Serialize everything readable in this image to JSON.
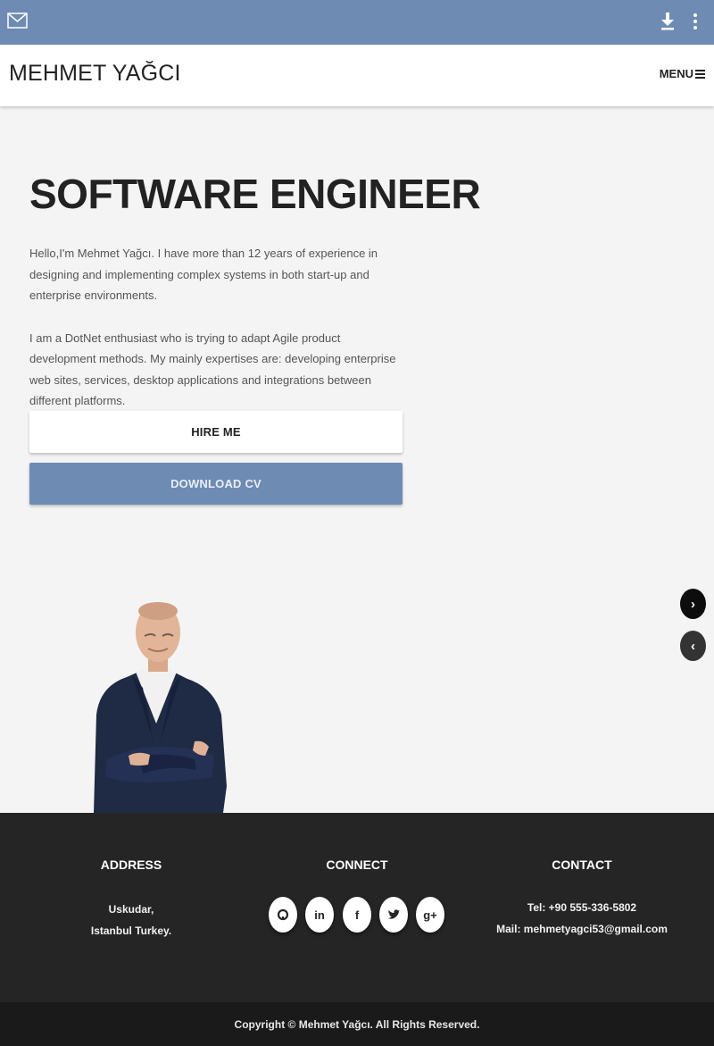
{
  "topbar": {
    "icons": [
      "mail-icon",
      "download-icon",
      "more-vert-icon"
    ],
    "color": "#6e8bb3"
  },
  "navbar": {
    "brand": "MEHMET YAĞCI",
    "menu_label": "MENU"
  },
  "hero": {
    "title": "SOFTWARE ENGINEER",
    "paragraph1": "Hello,I'm Mehmet Yağcı. I have more than 12 years of experience in designing and implementing complex systems in both start-up and enterprise environments.",
    "paragraph2": "I am a DotNet enthusiast who is trying to adapt Agile product development methods. My mainly expertises are: developing enterprise web sites, services, desktop applications and integrations between different platforms.",
    "hire_label": "HIRE ME",
    "cv_label": "DOWNLOAD CV"
  },
  "slider": {
    "next_icon": "›",
    "prev_icon": "‹"
  },
  "footer": {
    "address": {
      "title": "ADDRESS",
      "line1": "Uskudar,",
      "line2": "Istanbul Turkey."
    },
    "connect": {
      "title": "CONNECT",
      "links": [
        {
          "name": "github-icon",
          "glyph": "◯"
        },
        {
          "name": "linkedin-icon",
          "glyph": "in"
        },
        {
          "name": "facebook-icon",
          "glyph": "f"
        },
        {
          "name": "twitter-icon",
          "glyph": "🐦"
        },
        {
          "name": "google-plus-icon",
          "glyph": "g+"
        }
      ]
    },
    "contact": {
      "title": "CONTACT",
      "tel": "Tel: +90 555-336-5802",
      "mail": "Mail: mehmetyagci53@gmail.com"
    },
    "copyright": "Copyright © Mehmet Yağcı. All Rights Reserved."
  }
}
